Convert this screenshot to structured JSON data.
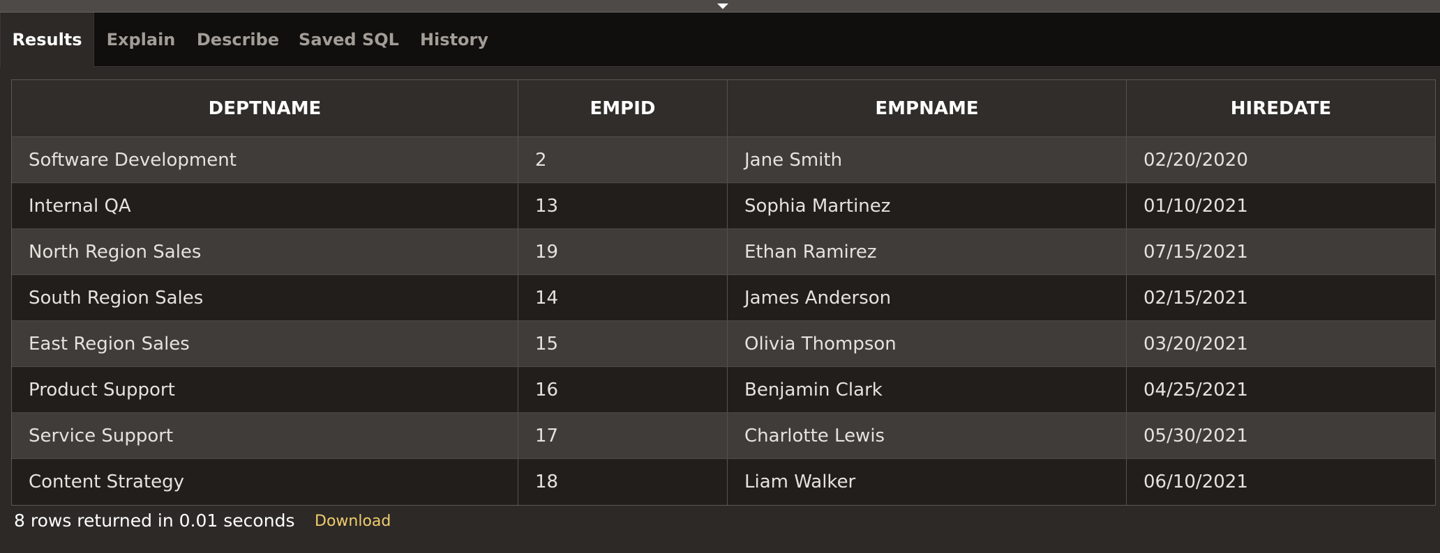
{
  "tabs": [
    {
      "label": "Results",
      "active": true
    },
    {
      "label": "Explain",
      "active": false
    },
    {
      "label": "Describe",
      "active": false
    },
    {
      "label": "Saved SQL",
      "active": false
    },
    {
      "label": "History",
      "active": false
    }
  ],
  "table": {
    "columns": [
      "DEPTNAME",
      "EMPID",
      "EMPNAME",
      "HIREDATE"
    ],
    "rows": [
      [
        "Software Development",
        "2",
        "Jane Smith",
        "02/20/2020"
      ],
      [
        "Internal QA",
        "13",
        "Sophia Martinez",
        "01/10/2021"
      ],
      [
        "North Region Sales",
        "19",
        "Ethan Ramirez",
        "07/15/2021"
      ],
      [
        "South Region Sales",
        "14",
        "James Anderson",
        "02/15/2021"
      ],
      [
        "East Region Sales",
        "15",
        "Olivia Thompson",
        "03/20/2021"
      ],
      [
        "Product Support",
        "16",
        "Benjamin Clark",
        "04/25/2021"
      ],
      [
        "Service Support",
        "17",
        "Charlotte Lewis",
        "05/30/2021"
      ],
      [
        "Content Strategy",
        "18",
        "Liam Walker",
        "06/10/2021"
      ]
    ]
  },
  "footer": {
    "status": "8 rows returned in 0.01 seconds",
    "download_label": "Download"
  },
  "splitter": {
    "icon": "caret-down-icon"
  },
  "colors": {
    "accent_link": "#f0cc6e",
    "tabbar_bg": "#100f0d",
    "row_odd": "#3f3c39",
    "row_even": "#211e1c"
  }
}
